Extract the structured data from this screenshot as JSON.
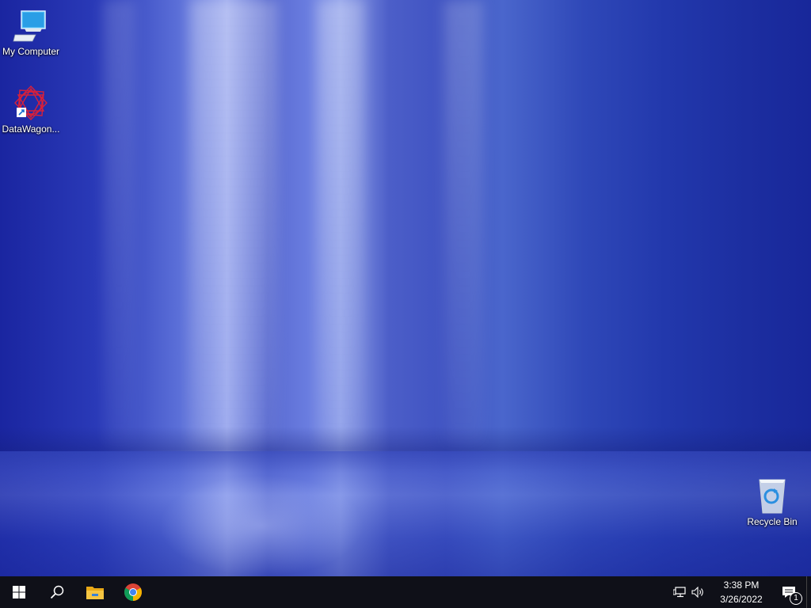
{
  "desktop": {
    "icons": [
      {
        "label": "My Computer",
        "icon": "my-computer-icon"
      },
      {
        "label": "DataWagon...",
        "icon": "datawagon-icon"
      },
      {
        "label": "Recycle Bin",
        "icon": "recycle-bin-icon"
      }
    ]
  },
  "taskbar": {
    "pinned": [
      "start-icon",
      "search-icon",
      "file-explorer-icon",
      "chrome-icon"
    ],
    "tray": {
      "network_icon": "network-icon",
      "volume_icon": "volume-icon",
      "time": "3:38 PM",
      "date": "3/26/2022",
      "notification_count": "1"
    }
  },
  "colors": {
    "taskbar": "#0f1018",
    "wallpaper_primary": "#2a3ab8",
    "start_icon": "#ffffff",
    "explorer_folder": "#f5c542"
  }
}
